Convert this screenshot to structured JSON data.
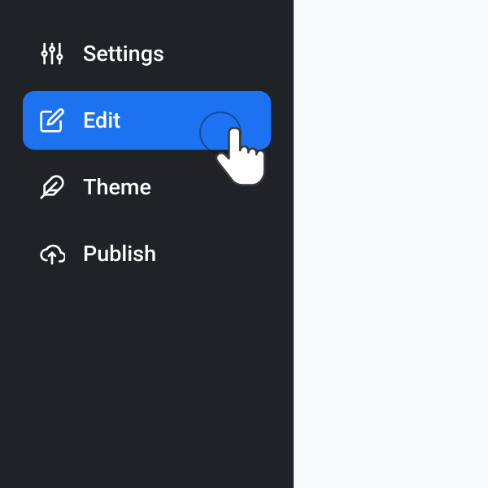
{
  "sidebar": {
    "items": [
      {
        "label": "Settings",
        "icon": "sliders-icon",
        "active": false
      },
      {
        "label": "Edit",
        "icon": "edit-icon",
        "active": true
      },
      {
        "label": "Theme",
        "icon": "feather-icon",
        "active": false
      },
      {
        "label": "Publish",
        "icon": "upload-cloud-icon",
        "active": false
      }
    ]
  },
  "colors": {
    "sidebar_bg": "#1f2328",
    "active_bg": "#1d72f2",
    "text": "#ffffff",
    "main_bg": "#f8f9fb"
  }
}
